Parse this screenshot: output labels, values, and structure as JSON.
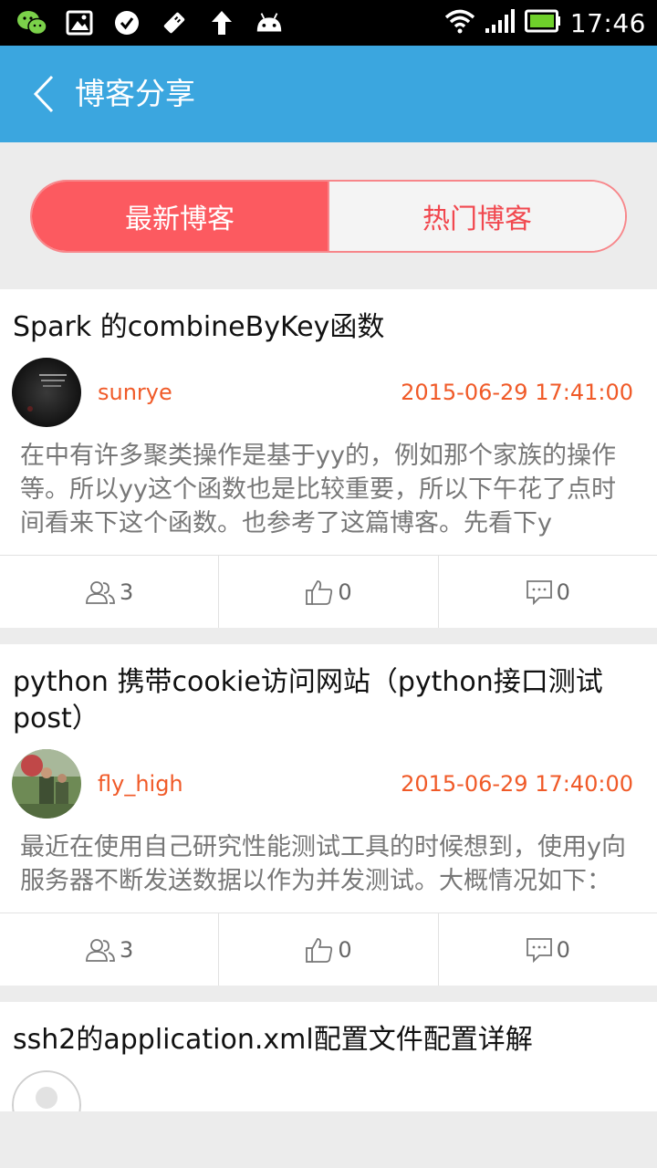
{
  "status_bar": {
    "time": "17:46",
    "icons_left": [
      "wechat-icon",
      "image-icon",
      "check-circle-icon",
      "usb-debug-icon",
      "upload-arrow-icon",
      "android-icon"
    ],
    "icons_right": [
      "wifi-icon",
      "signal-icon",
      "battery-icon"
    ]
  },
  "header": {
    "title": "博客分享"
  },
  "tabs": {
    "latest": "最新博客",
    "hot": "热门博客"
  },
  "colors": {
    "header_bg": "#3ba6df",
    "tab_active_bg": "#fc5a60",
    "accent_text": "#f05a28"
  },
  "posts": [
    {
      "title": "Spark 的combineByKey函数",
      "author": "sunrye",
      "date": "2015-06-29 17:41:00",
      "summary": "在中有许多聚类操作是基于yy的，例如那个家族的操作等。所以yy这个函数也是比较重要，所以下午花了点时间看来下这个函数。也参考了这篇博客。先看下y",
      "views": "3",
      "likes": "0",
      "comments": "0"
    },
    {
      "title": "python 携带cookie访问网站（python接口测试post）",
      "author": "fly_high",
      "date": "2015-06-29 17:40:00",
      "summary": "最近在使用自己研究性能测试工具的时候想到，使用y向服务器不断发送数据以作为并发测试。大概情况如下：",
      "views": "3",
      "likes": "0",
      "comments": "0"
    },
    {
      "title": "ssh2的application.xml配置文件配置详解"
    }
  ]
}
